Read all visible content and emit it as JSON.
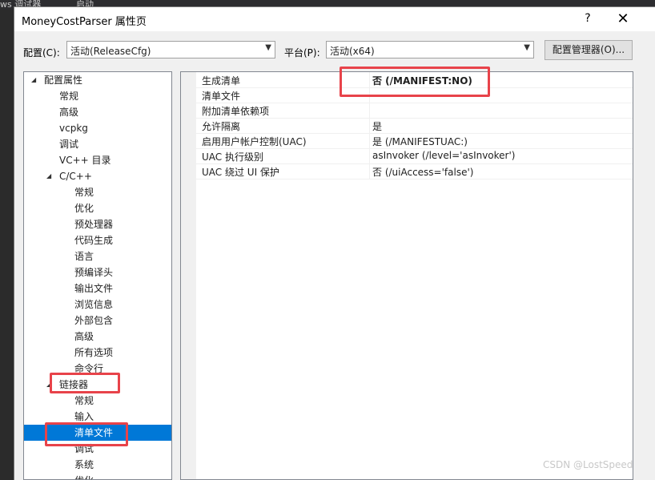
{
  "background": {
    "strip_left": "ws 调试器",
    "strip_mid": "启动"
  },
  "window": {
    "title": "MoneyCostParser 属性页",
    "help_label": "?",
    "close_label": "✕"
  },
  "toolbar": {
    "config_label": "配置(C):",
    "config_value": "活动(ReleaseCfg)",
    "platform_label": "平台(P):",
    "platform_value": "活动(x64)",
    "config_manager_label": "配置管理器(O)..."
  },
  "tree": {
    "items": [
      {
        "label": "配置属性",
        "expander": "◢"
      },
      {
        "label": "常规"
      },
      {
        "label": "高级"
      },
      {
        "label": "vcpkg"
      },
      {
        "label": "调试"
      },
      {
        "label": "VC++ 目录"
      },
      {
        "label": "C/C++",
        "expander": "◢"
      },
      {
        "label": "常规"
      },
      {
        "label": "优化"
      },
      {
        "label": "预处理器"
      },
      {
        "label": "代码生成"
      },
      {
        "label": "语言"
      },
      {
        "label": "预编译头"
      },
      {
        "label": "输出文件"
      },
      {
        "label": "浏览信息"
      },
      {
        "label": "外部包含"
      },
      {
        "label": "高级"
      },
      {
        "label": "所有选项"
      },
      {
        "label": "命令行"
      },
      {
        "label": "链接器",
        "expander": "◢"
      },
      {
        "label": "常规"
      },
      {
        "label": "输入"
      },
      {
        "label": "清单文件",
        "selected": true
      },
      {
        "label": "调试"
      },
      {
        "label": "系统"
      },
      {
        "label": "优化"
      }
    ]
  },
  "grid": {
    "rows": [
      {
        "name": "生成清单",
        "value": "否 (/MANIFEST:NO)"
      },
      {
        "name": "清单文件",
        "value": ""
      },
      {
        "name": "附加清单依赖项",
        "value": ""
      },
      {
        "name": "允许隔离",
        "value": "是"
      },
      {
        "name": "启用用户帐户控制(UAC)",
        "value": "是 (/MANIFESTUAC:)"
      },
      {
        "name": "UAC 执行级别",
        "value": "asInvoker (/level='asInvoker')"
      },
      {
        "name": "UAC 绕过 UI 保护",
        "value": "否 (/uiAccess='false')"
      }
    ]
  },
  "watermark": "CSDN @LostSpeed",
  "colors": {
    "highlight_box": "#e8434a",
    "selection": "#0078d7"
  }
}
